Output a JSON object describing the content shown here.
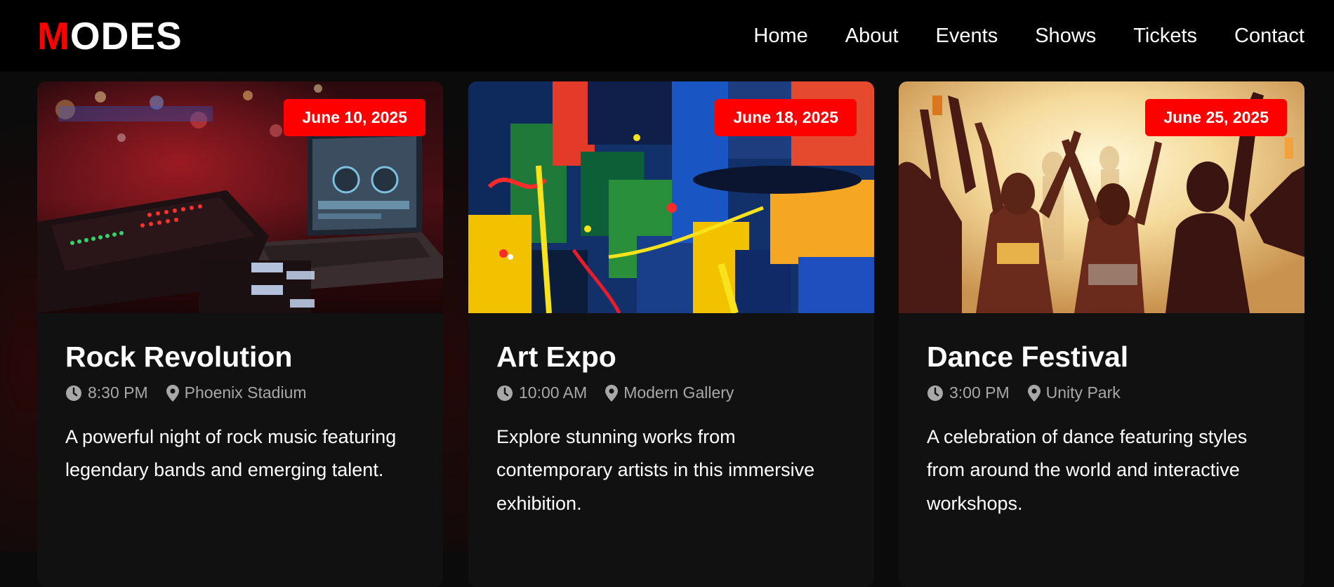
{
  "brand": {
    "logo_first": "M",
    "logo_rest": "ODES",
    "accent_color": "#ff0000"
  },
  "nav": {
    "items": [
      "Home",
      "About",
      "Events",
      "Shows",
      "Tickets",
      "Contact"
    ]
  },
  "events": [
    {
      "title": "Rock Revolution",
      "date": "June 10, 2025",
      "time": "8:30 PM",
      "venue": "Phoenix Stadium",
      "description": "A powerful night of rock music featuring legendary bands and emerging talent.",
      "image": "dj-mixer-laptop-photo"
    },
    {
      "title": "Art Expo",
      "date": "June 18, 2025",
      "time": "10:00 AM",
      "venue": "Modern Gallery",
      "description": "Explore stunning works from contemporary artists in this immersive exhibition.",
      "image": "abstract-painting-photo"
    },
    {
      "title": "Dance Festival",
      "date": "June 25, 2025",
      "time": "3:00 PM",
      "venue": "Unity Park",
      "description": "A celebration of dance featuring styles from around the world and interactive workshops.",
      "image": "dancing-crowd-photo"
    }
  ],
  "icons": {
    "time": "clock-icon",
    "location": "map-pin-icon"
  }
}
